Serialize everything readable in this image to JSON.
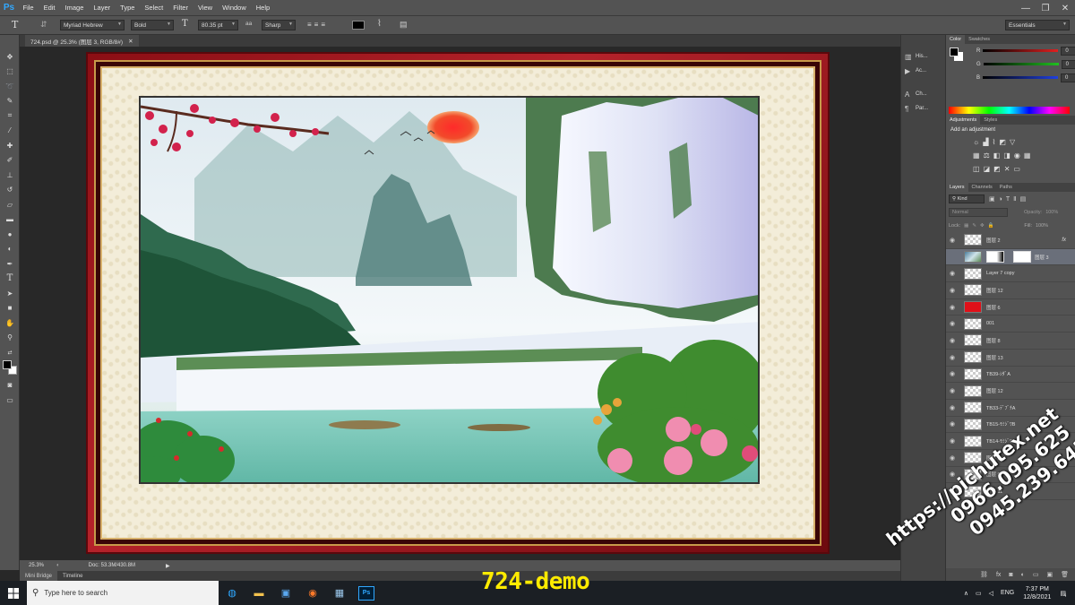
{
  "app": {
    "logo": "Ps"
  },
  "menu": [
    "File",
    "Edit",
    "Image",
    "Layer",
    "Type",
    "Select",
    "Filter",
    "View",
    "Window",
    "Help"
  ],
  "window_controls": {
    "minimize": "—",
    "maximize": "❐",
    "close": "✕"
  },
  "options_bar": {
    "font_family": "Myriad Hebrew",
    "font_style": "Bold",
    "font_size": "80.35 pt",
    "antialias_label": "aa",
    "antialias": "Sharp",
    "workspace": "Essentials"
  },
  "document_tab": {
    "label": "724.psd @ 25.3% (图层 3, RGB/8#)",
    "close": "✕"
  },
  "status_bar": {
    "zoom": "25.3%",
    "doc": "Doc: 53.3M/430.8M"
  },
  "bridge_tabs": [
    "Mini Bridge",
    "Timeline"
  ],
  "dock": [
    {
      "icon": "history-icon",
      "label": "His..."
    },
    {
      "icon": "actions-icon",
      "label": "Ac..."
    },
    {
      "icon": "character-icon",
      "label": "Ch..."
    },
    {
      "icon": "paragraph-icon",
      "label": "Par..."
    }
  ],
  "color_panel": {
    "tabs": [
      "Color",
      "Swatches"
    ],
    "channels": [
      {
        "label": "R",
        "value": "0",
        "color": "#e02020"
      },
      {
        "label": "G",
        "value": "0",
        "color": "#20c020"
      },
      {
        "label": "B",
        "value": "0",
        "color": "#2040e0"
      }
    ]
  },
  "adjustments_panel": {
    "tabs": [
      "Adjustments",
      "Styles"
    ],
    "heading": "Add an adjustment"
  },
  "layers_panel": {
    "tabs": [
      "Layers",
      "Channels",
      "Paths"
    ],
    "filter": "Kind",
    "blend": "Normal",
    "opacity_label": "Opacity:",
    "opacity": "100%",
    "lock_label": "Lock:",
    "fill_label": "Fill:",
    "fill": "100%",
    "layers": [
      {
        "name": "图层 2",
        "thumb": "checker",
        "fx": "fx",
        "visible": true
      },
      {
        "name": "图层 3",
        "thumb": "photo",
        "selected": true,
        "visible": false
      },
      {
        "name": "Layer 7 copy",
        "thumb": "checker",
        "visible": true
      },
      {
        "name": "图层 12",
        "thumb": "checker",
        "visible": true
      },
      {
        "name": "图层 6",
        "thumb": "red",
        "visible": true
      },
      {
        "name": "001",
        "thumb": "checker",
        "visible": true
      },
      {
        "name": "图层 8",
        "thumb": "checker",
        "visible": true
      },
      {
        "name": "图层 13",
        "thumb": "checker",
        "visible": true
      },
      {
        "name": "TB39-ｼﾀﾞA",
        "thumb": "checker",
        "visible": true
      },
      {
        "name": "图层 12",
        "thumb": "checker",
        "visible": true
      },
      {
        "name": "TB33-ﾃﾞﾌﾞﾁA",
        "thumb": "checker",
        "visible": true
      },
      {
        "name": "TB15-ﾓﾐｼﾞﾜB",
        "thumb": "checker",
        "visible": true
      },
      {
        "name": "TB14-ﾓﾐｼﾞﾜA",
        "thumb": "checker",
        "visible": true
      },
      {
        "name": "图层 10",
        "thumb": "checker",
        "visible": true
      },
      {
        "name": "图层 9",
        "thumb": "checker",
        "visible": true
      },
      {
        "name": "图层 11",
        "thumb": "checker",
        "visible": true
      }
    ]
  },
  "taskbar": {
    "search_placeholder": "Type here to search",
    "apps": [
      "edge-icon",
      "file-explorer-icon",
      "store-icon",
      "firefox-icon",
      "calculator-icon",
      "photoshop-icon"
    ],
    "tray_lang": "ENG",
    "time": "7:37 PM",
    "date": "12/8/2021",
    "notification_count": "4"
  },
  "overlay": {
    "demo_label": "724-demo",
    "watermark_lines": [
      "https://pichutex.net",
      "0966.095.625",
      "0945.239.643"
    ]
  }
}
